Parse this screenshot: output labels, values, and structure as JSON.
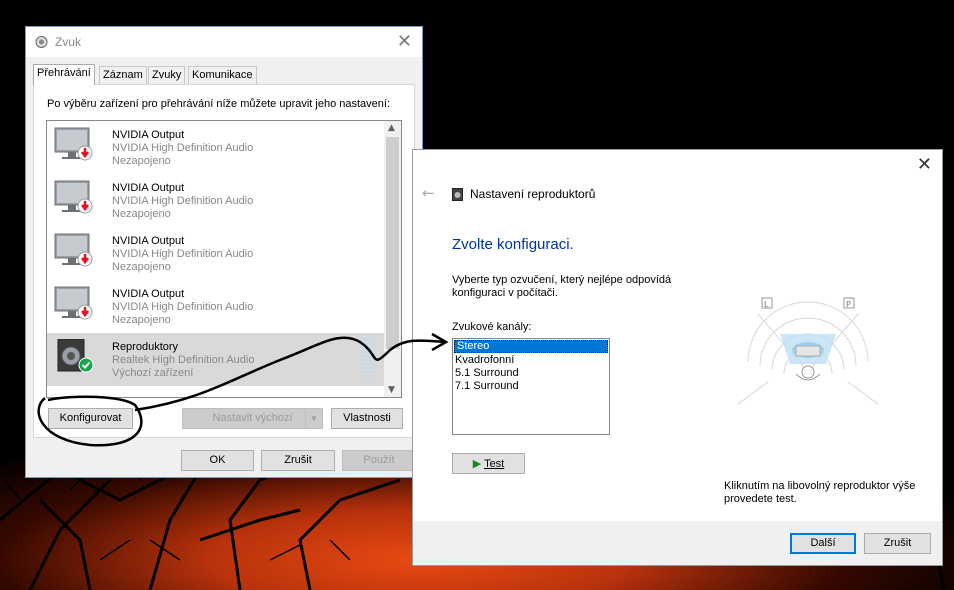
{
  "sound_window": {
    "title": "Zvuk",
    "close_glyph": "✕",
    "tabs": [
      {
        "label": "Přehrávání",
        "active": true
      },
      {
        "label": "Záznam",
        "active": false
      },
      {
        "label": "Zvuky",
        "active": false
      },
      {
        "label": "Komunikace",
        "active": false
      }
    ],
    "hint": "Po výběru zařízení pro přehrávání níže můžete upravit jeho nastavení:",
    "devices": [
      {
        "name": "NVIDIA Output",
        "driver": "NVIDIA High Definition Audio",
        "status": "Nezapojeno",
        "icon": "monitor-unplugged-icon"
      },
      {
        "name": "NVIDIA Output",
        "driver": "NVIDIA High Definition Audio",
        "status": "Nezapojeno",
        "icon": "monitor-unplugged-icon"
      },
      {
        "name": "NVIDIA Output",
        "driver": "NVIDIA High Definition Audio",
        "status": "Nezapojeno",
        "icon": "monitor-unplugged-icon"
      },
      {
        "name": "NVIDIA Output",
        "driver": "NVIDIA High Definition Audio",
        "status": "Nezapojeno",
        "icon": "monitor-unplugged-icon"
      },
      {
        "name": "Reproduktory",
        "driver": "Realtek High Definition Audio",
        "status": "Výchozí zařízení",
        "icon": "speaker-default-icon",
        "selected": true
      }
    ],
    "buttons": {
      "configure": "Konfigurovat",
      "set_default": "Nastavit výchozí",
      "properties": "Vlastnosti",
      "ok": "OK",
      "cancel": "Zrušit",
      "apply": "Použít"
    }
  },
  "setup_window": {
    "close_glyph": "✕",
    "back_glyph": "←",
    "title": "Nastavení reproduktorů",
    "heading": "Zvolte konfiguraci.",
    "description": "Vyberte typ ozvučení, který nejlépe odpovídá konfiguraci v počítači.",
    "channels_label": "Zvukové kanály:",
    "channels": [
      "Stereo",
      "Kvadrofonní",
      "5.1 Surround",
      "7.1 Surround"
    ],
    "selected_channel": "Stereo",
    "test_button": "Test",
    "speaker_labels": {
      "left": "L",
      "right": "P"
    },
    "note": "Kliknutím na libovolný reproduktor výše provedete test.",
    "next_button": "Další",
    "cancel_button": "Zrušit"
  },
  "colors": {
    "accent": "#0078d7",
    "heading": "#003399",
    "unplugged": "#e81123",
    "default_ok": "#16a34a"
  }
}
